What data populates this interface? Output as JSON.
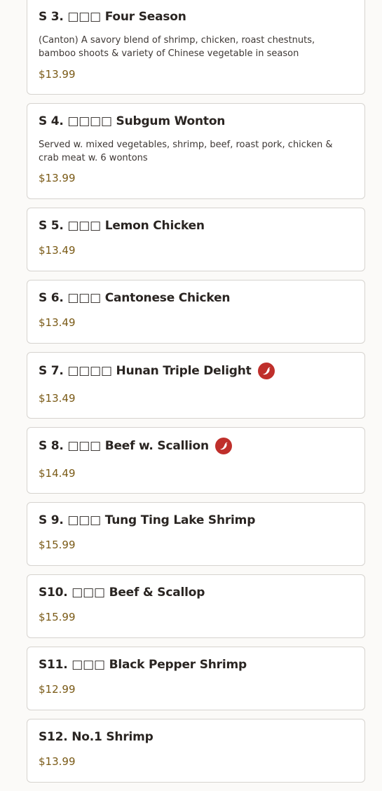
{
  "colors": {
    "price": "#7a5a16",
    "spicy_badge": "#bf2f2b",
    "card_border": "#d6d3cf"
  },
  "menu_items": [
    {
      "code": "S 3.",
      "chinese": "□□□",
      "name": "Four Season",
      "description": "(Canton) A savory blend of shrimp, chicken, roast chestnuts, bamboo shoots & variety of Chinese vegetable in season",
      "price": "$13.99",
      "spicy": false,
      "spicy_icon": ""
    },
    {
      "code": "S 4.",
      "chinese": "□□□□",
      "name": "Subgum Wonton",
      "description": "Served w. mixed vegetables, shrimp, beef, roast pork, chicken & crab meat w. 6 wontons",
      "price": "$13.99",
      "spicy": false,
      "spicy_icon": ""
    },
    {
      "code": "S 5.",
      "chinese": "□□□",
      "name": "Lemon Chicken",
      "description": "",
      "price": "$13.49",
      "spicy": false,
      "spicy_icon": ""
    },
    {
      "code": "S 6.",
      "chinese": "□□□",
      "name": "Cantonese Chicken",
      "description": "",
      "price": "$13.49",
      "spicy": false,
      "spicy_icon": ""
    },
    {
      "code": "S 7.",
      "chinese": "□□□□",
      "name": "Hunan Triple Delight",
      "description": "",
      "price": "$13.49",
      "spicy": true,
      "spicy_icon": "chili-pepper-icon"
    },
    {
      "code": "S 8.",
      "chinese": "□□□",
      "name": "Beef w. Scallion",
      "description": "",
      "price": "$14.49",
      "spicy": true,
      "spicy_icon": "chili-pepper-icon"
    },
    {
      "code": "S 9.",
      "chinese": "□□□",
      "name": "Tung Ting Lake Shrimp",
      "description": "",
      "price": "$15.99",
      "spicy": false,
      "spicy_icon": ""
    },
    {
      "code": "S10.",
      "chinese": "□□□",
      "name": "Beef & Scallop",
      "description": "",
      "price": "$15.99",
      "spicy": false,
      "spicy_icon": ""
    },
    {
      "code": "S11.",
      "chinese": "□□□",
      "name": "Black Pepper Shrimp",
      "description": "",
      "price": "$12.99",
      "spicy": false,
      "spicy_icon": ""
    },
    {
      "code": "S12.",
      "chinese": "",
      "name": "No.1 Shrimp",
      "description": "",
      "price": "$13.99",
      "spicy": false,
      "spicy_icon": ""
    }
  ]
}
